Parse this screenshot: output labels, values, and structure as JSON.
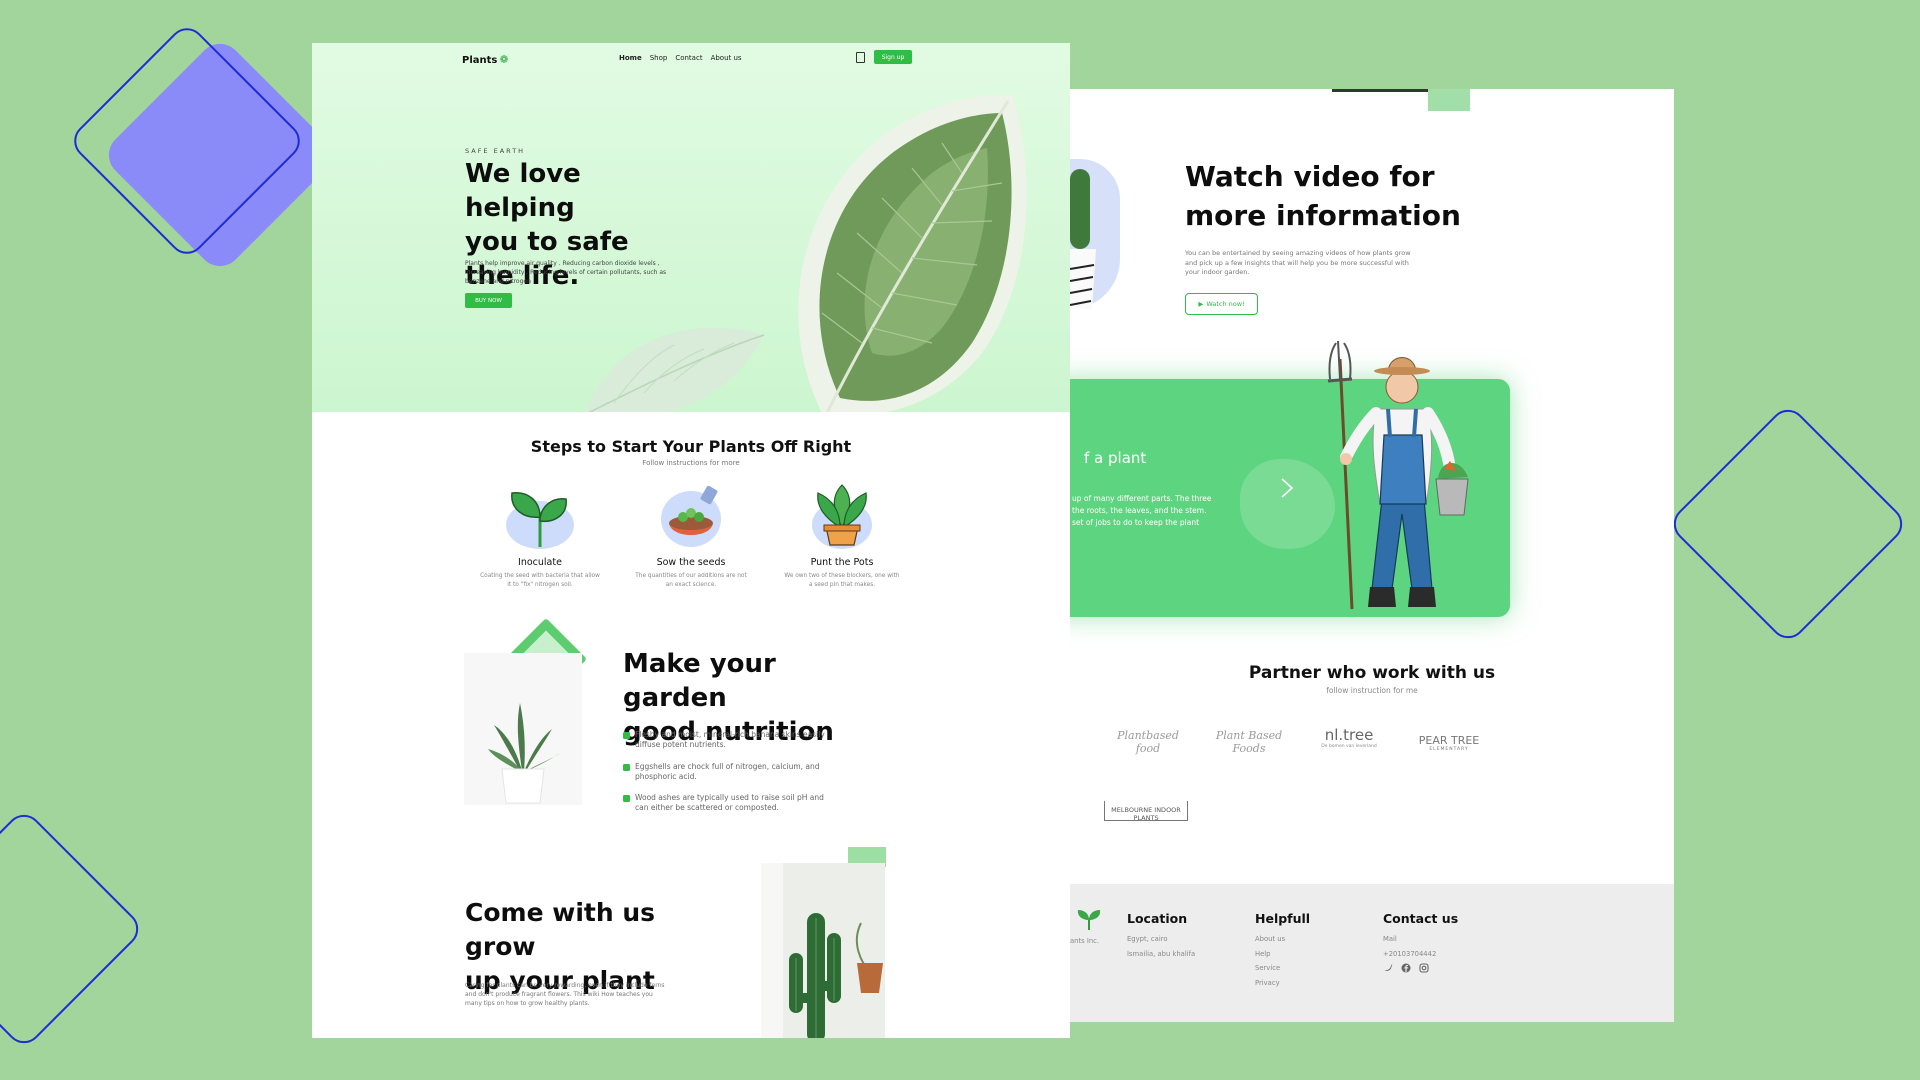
{
  "left_page": {
    "nav": {
      "logo": "Plants",
      "links": [
        "Home",
        "Shop",
        "Contact",
        "About us"
      ],
      "signup": "Sign up"
    },
    "hero": {
      "eyebrow": "SAFE EARTH",
      "title_line1": "We love helping",
      "title_line2": "you to safe",
      "title_line3": "the life.",
      "description": "Plants help improve air quality . Reducing carbon dioxide levels , Increasing humidity . Reducing levels of certain pollutants, such as benzene and nitrogen",
      "button": "BUY NOW"
    },
    "steps": {
      "title": "Steps to Start Your Plants Off Right",
      "subtitle": "Follow instructions for more",
      "items": [
        {
          "name": "Inoculate",
          "desc": "Coating the seed with bacteria that allow it to \"fix\" nitrogen soil."
        },
        {
          "name": "Sow the seeds",
          "desc": "The quantities of our additions are not an exact science."
        },
        {
          "name": "Punt the Pots",
          "desc": "We own two of these blockers, one with a seed pin that makes."
        }
      ]
    },
    "nutrition": {
      "title_line1": "Make your garden",
      "title_line2": "good nutrition",
      "bullets": [
        "Fleshy and moist, mineral-rich banana skins easily diffuse potent nutrients.",
        "Eggshells are chock full of nitrogen, calcium, and phosphoric acid.",
        "Wood ashes are typically used to raise soil pH and can either be scattered or composted."
      ]
    },
    "grow": {
      "title_line1": "Come with us grow",
      "title_line2": "up your plant",
      "description": "Caring for plants can be very rewarding, even if they include ferns and don't produce fragrant flowers. This wiki How teaches you many tips on how to grow healthy plants."
    }
  },
  "right_page": {
    "video": {
      "title_line1": "Watch video for",
      "title_line2": "more information",
      "description": "You can be entertained by seeing amazing videos of how plants grow and pick up a few insights that will help you be more successful with your indoor garden.",
      "button": "Watch now!"
    },
    "card": {
      "title": "f a plant",
      "desc_line1": "up of many different parts. The three",
      "desc_line2": "the roots, the leaves, and the stem.",
      "desc_line3": "set of jobs to do to keep the plant"
    },
    "partners": {
      "title": "Partner who work with us",
      "subtitle": "follow instruction for me",
      "logos": [
        "Plantbased food",
        "Plant Based Foods",
        "nl.tree",
        "PEAR TREE",
        "MELBOURNE INDOOR PLANTS"
      ],
      "logo_nl_tagline": "De bomen van leverland",
      "logo_pear_tagline": "ELEMENTARY",
      "logo_plantbased_small": "FOODS"
    },
    "footer": {
      "brand_fragment": "ants Inc.",
      "location": {
        "title": "Location",
        "items": [
          "Egypt, cairo",
          "Ismailia, abu khalifa"
        ]
      },
      "helpful": {
        "title": "Helpfull",
        "items": [
          "About us",
          "Help",
          "Service",
          "Privacy"
        ]
      },
      "contact": {
        "title": "Contact us",
        "items": [
          "Mail",
          "+20103704442"
        ]
      },
      "social_icons": [
        "twitter-icon",
        "facebook-icon",
        "instagram-icon"
      ]
    }
  },
  "colors": {
    "background": "#a2d59c",
    "accent_green": "#2fbd45",
    "card_green": "#5dd47f",
    "deco_purple": "#8a8bf8",
    "deco_blue": "#1e2bd6"
  }
}
